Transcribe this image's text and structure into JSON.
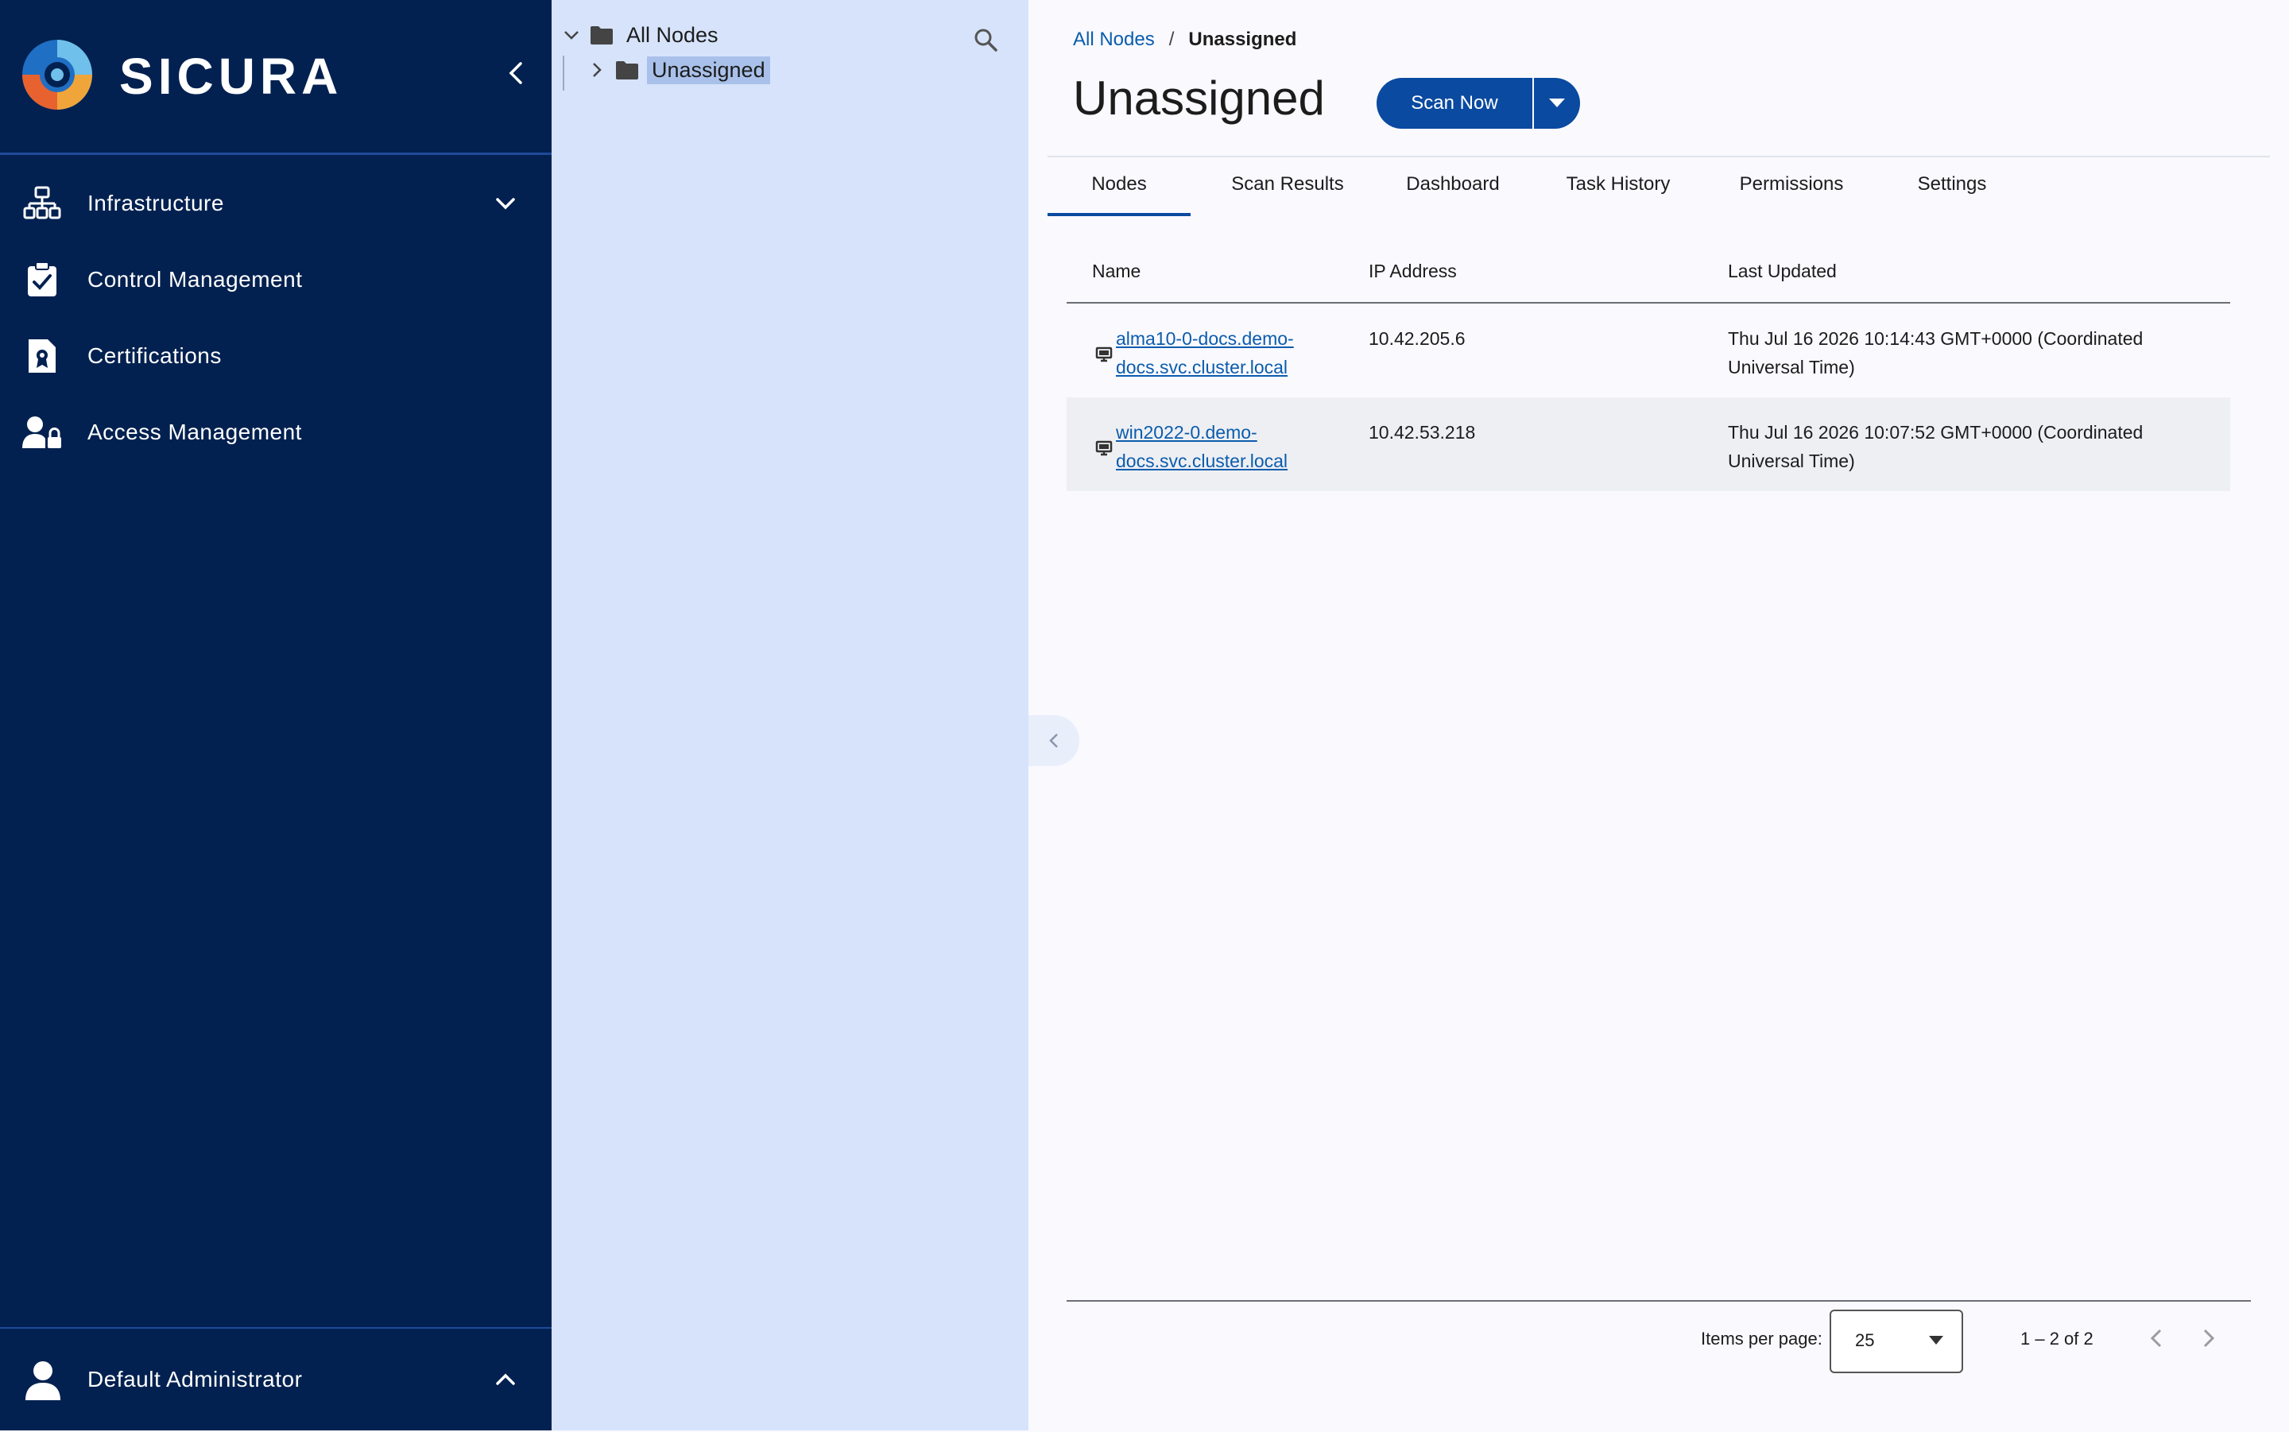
{
  "sidebar": {
    "brand": "SICURA",
    "items": [
      {
        "label": "Infrastructure",
        "icon": "network-icon"
      },
      {
        "label": "Control Management",
        "icon": "clipboard-check-icon"
      },
      {
        "label": "Certifications",
        "icon": "certificate-document-icon"
      },
      {
        "label": "Access Management",
        "icon": "user-lock-icon"
      }
    ],
    "user": "Default Administrator"
  },
  "tree": {
    "root": "All Nodes",
    "child": "Unassigned"
  },
  "breadcrumb": {
    "root": "All Nodes",
    "separator": "/",
    "current": "Unassigned"
  },
  "page": {
    "title": "Unassigned",
    "scan_label": "Scan Now"
  },
  "tabs": [
    "Nodes",
    "Scan Results",
    "Dashboard",
    "Task History",
    "Permissions",
    "Settings"
  ],
  "table": {
    "headers": [
      "Name",
      "IP Address",
      "Last Updated"
    ],
    "rows": [
      {
        "name_line1": "alma10-0-docs.demo-",
        "name_line2": "docs.svc.cluster.local",
        "ip": "10.42.205.6",
        "updated_line1": "Thu Jul 16 2026 10:14:43 GMT+0000 (Coordinated",
        "updated_line2": "Universal Time)"
      },
      {
        "name_line1": "win2022-0.demo-",
        "name_line2": "docs.svc.cluster.local",
        "ip": "10.42.53.218",
        "updated_line1": "Thu Jul 16 2026 10:07:52 GMT+0000 (Coordinated",
        "updated_line2": "Universal Time)"
      }
    ]
  },
  "pagination": {
    "items_per_page_label": "Items per page:",
    "items_per_page": "25",
    "range": "1 – 2 of 2"
  },
  "colors": {
    "sidebar": "#022150",
    "tree_panel": "#d6e3fb",
    "accent": "#0a4aa0",
    "link": "#0b5cad"
  }
}
